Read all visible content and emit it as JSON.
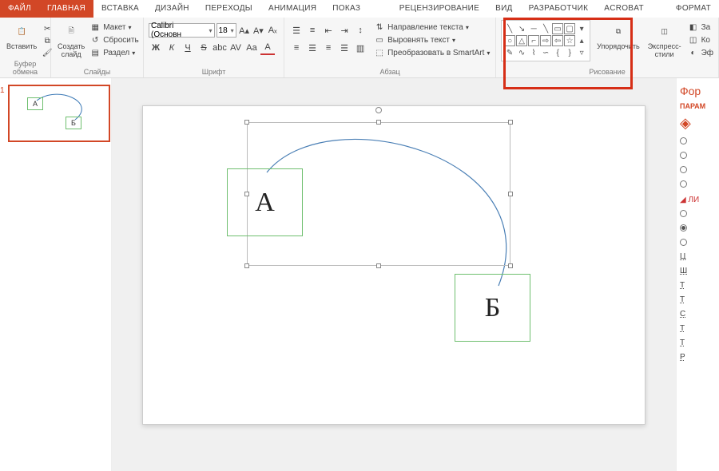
{
  "tabs": {
    "file": "ФАЙЛ",
    "home": "ГЛАВНАЯ",
    "insert": "ВСТАВКА",
    "design": "ДИЗАЙН",
    "transitions": "ПЕРЕХОДЫ",
    "animation": "АНИМАЦИЯ",
    "slideshow": "ПОКАЗ СЛАЙДОВ",
    "review": "РЕЦЕНЗИРОВАНИЕ",
    "view": "ВИД",
    "developer": "РАЗРАБОТЧИК",
    "acrobat": "ACROBAT",
    "format": "ФОРМАТ"
  },
  "ribbon": {
    "clipboard": {
      "paste": "Вставить",
      "label": "Буфер обмена"
    },
    "slides": {
      "newslide": "Создать\nслайд",
      "layout": "Макет",
      "reset": "Сбросить",
      "section": "Раздел",
      "label": "Слайды"
    },
    "font": {
      "family": "Calibri (Основн",
      "size": "18",
      "label": "Шрифт"
    },
    "paragraph": {
      "textdir": "Направление текста",
      "align": "Выровнять текст",
      "smartart": "Преобразовать в SmartArt",
      "label": "Абзац"
    },
    "drawing": {
      "arrange": "Упорядочить",
      "styles": "Экспресс-\nстили",
      "label": "Рисование",
      "fill": "За",
      "outline": "Ко",
      "effects": "Эф"
    }
  },
  "thumb": {
    "num": "1",
    "a": "А",
    "b": "Б"
  },
  "slide": {
    "a": "А",
    "b": "Б"
  },
  "panel": {
    "header": "Фор",
    "sub": "ПАРАМ",
    "line_hd": "ЛИ",
    "items": [
      "Ц",
      "Ш",
      "Т",
      "Т",
      "С",
      "Т",
      "Т",
      "Р"
    ]
  }
}
